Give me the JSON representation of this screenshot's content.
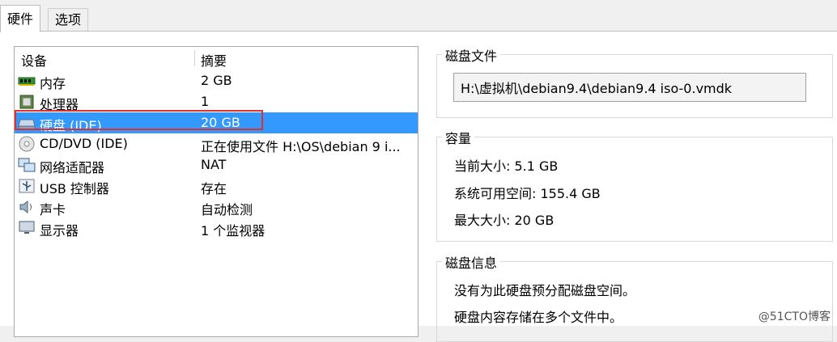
{
  "tabs": [
    {
      "label": "硬件"
    },
    {
      "label": "选项"
    }
  ],
  "device_list": {
    "columns": {
      "device": "设备",
      "summary": "摘要"
    },
    "rows": [
      {
        "name": "内存",
        "summary": "2 GB",
        "icon": "memory-icon"
      },
      {
        "name": "处理器",
        "summary": "1",
        "icon": "processor-icon"
      },
      {
        "name": "硬盘 (IDE)",
        "summary": "20 GB",
        "icon": "hard-disk-icon",
        "selected": true
      },
      {
        "name": "CD/DVD (IDE)",
        "summary": "正在使用文件 H:\\OS\\debian 9 i...",
        "icon": "cd-dvd-icon"
      },
      {
        "name": "网络适配器",
        "summary": "NAT",
        "icon": "network-adapter-icon"
      },
      {
        "name": "USB 控制器",
        "summary": "存在",
        "icon": "usb-icon"
      },
      {
        "name": "声卡",
        "summary": "自动检测",
        "icon": "sound-card-icon"
      },
      {
        "name": "显示器",
        "summary": "1 个监视器",
        "icon": "display-icon"
      }
    ]
  },
  "disk_file": {
    "legend": "磁盘文件",
    "path": "H:\\虚拟机\\debian9.4\\debian9.4 iso-0.vmdk"
  },
  "capacity": {
    "legend": "容量",
    "current_size": "当前大小: 5.1 GB",
    "available": "系统可用空间: 155.4 GB",
    "max_size": "最大大小: 20 GB"
  },
  "disk_info": {
    "legend": "磁盘信息",
    "line1": "没有为此硬盘预分配磁盘空间。",
    "line2": "硬盘内容存储在多个文件中。"
  },
  "watermark": "@51CTO博客",
  "colors": {
    "selection": "#3399ff",
    "highlight_box": "#e0302b"
  }
}
